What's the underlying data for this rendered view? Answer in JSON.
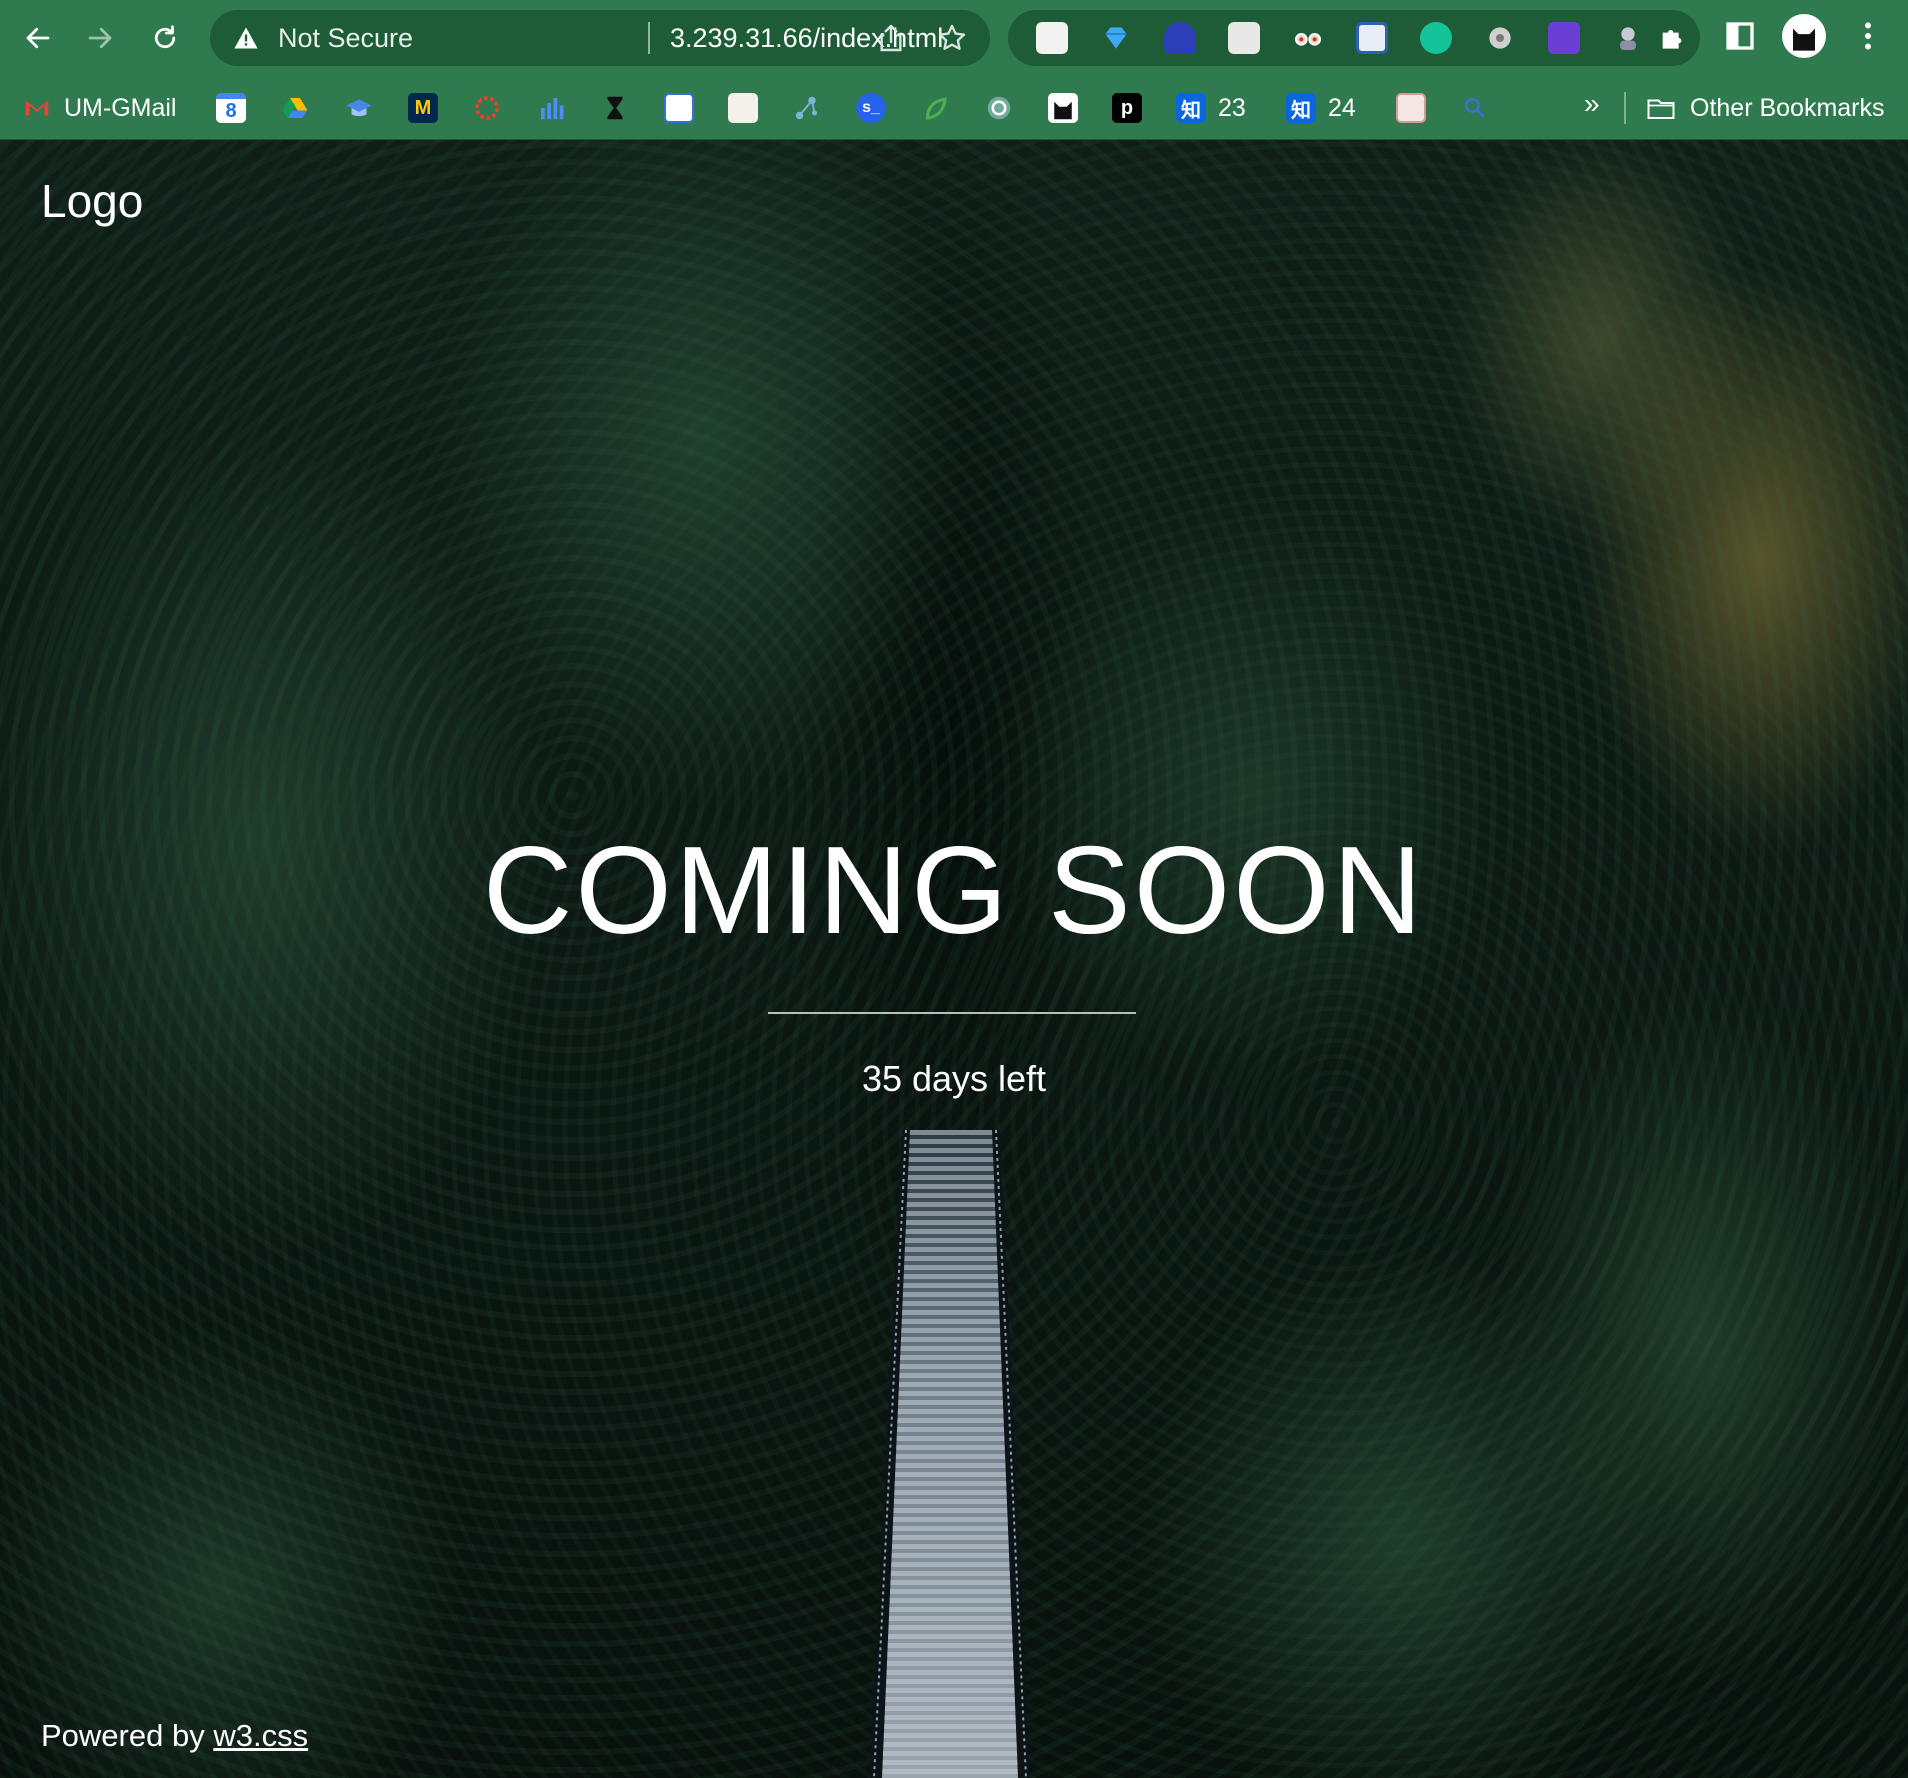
{
  "browser": {
    "security_label": "Not Secure",
    "url": "3.239.31.66/index.html",
    "nav_icons": [
      "back-arrow-icon",
      "forward-arrow-icon",
      "reload-icon"
    ],
    "extension_icons": [
      "readwise-icon",
      "diamond-icon",
      "ghost-icon",
      "document-icon",
      "glasses-icon",
      "card-icon",
      "grammarly-icon",
      "gear-icon",
      "notes-icon",
      "astronaut-icon",
      "puzzle-icon"
    ],
    "bookmarks": [
      {
        "label": "UM-GMail",
        "icon": "gmail-icon"
      },
      {
        "label": "",
        "icon": "calendar-icon"
      },
      {
        "label": "",
        "icon": "drive-icon"
      },
      {
        "label": "",
        "icon": "graduation-cap-icon"
      },
      {
        "label": "",
        "icon": "michigan-icon"
      },
      {
        "label": "",
        "icon": "asterisk-icon"
      },
      {
        "label": "",
        "icon": "bar-chart-icon"
      },
      {
        "label": "",
        "icon": "hourglass-icon"
      },
      {
        "label": "",
        "icon": "barcode-icon"
      },
      {
        "label": "",
        "icon": "sketch-icon"
      },
      {
        "label": "",
        "icon": "graph-icon"
      },
      {
        "label": "",
        "icon": "s-terminal-icon"
      },
      {
        "label": "",
        "icon": "leaf-icon"
      },
      {
        "label": "",
        "icon": "openai-icon"
      },
      {
        "label": "",
        "icon": "cat-icon"
      },
      {
        "label": "",
        "icon": "p-icon"
      },
      {
        "label": "23",
        "icon": "zhihu-icon"
      },
      {
        "label": "24",
        "icon": "zhihu-icon"
      },
      {
        "label": "",
        "icon": "pattern-icon"
      },
      {
        "label": "",
        "icon": "search-icon"
      }
    ],
    "calendar_day": "8",
    "p_glyph": "p",
    "zhihu_glyph": "知",
    "more_label": "»",
    "other_bookmarks_label": "Other Bookmarks"
  },
  "page": {
    "logo": "Logo",
    "headline": "COMING SOON",
    "countdown": "35 days left",
    "footer_prefix": "Powered by ",
    "footer_link": "w3.css"
  },
  "colors": {
    "chrome_bg": "#2f7a4e",
    "omnibox_bg": "#1e5c38",
    "text": "#ffffff"
  }
}
